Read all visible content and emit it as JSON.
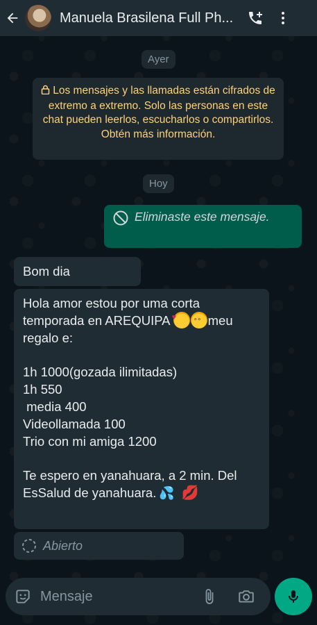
{
  "header": {
    "contact_name": "Manuela Brasilena Full Ph..."
  },
  "chat": {
    "date_yesterday": "Ayer",
    "encryption_notice": "Los mensajes y las llamadas están cifrados de extremo a extremo. Solo las personas en este chat pueden leerlos, escucharlos o compartirlos. Obtén más información.",
    "date_today": "Hoy",
    "outgoing_deleted": "Eliminaste este mensaje.",
    "incoming_1": "Bom dia",
    "incoming_2": {
      "line1": "Hola amor estou por uma corta",
      "line2": "temporada en AREQUIPA",
      "line2b": "meu",
      "line3": "regalo e:",
      "line4": "1h 1000(gozada ilimitadas)",
      "line5": "1h 550",
      "line6": " media 400",
      "line7": "Videollamada 100",
      "line8": "Trio con mi amiga 1200",
      "line9": "Te espero en yanahuara, a 2 min. Del",
      "line10": "EsSalud de yanahuara."
    },
    "view_once": "Abierto"
  },
  "composer": {
    "placeholder": "Mensaje"
  },
  "colors": {
    "background": "#0b141a",
    "header": "#1f2c34",
    "outgoing": "#005c4b",
    "incoming": "#1f2c34",
    "accent": "#00a884",
    "notice_text": "#ffd279"
  },
  "icons": [
    "back-arrow-icon",
    "add-call-icon",
    "more-vert-icon",
    "lock-icon",
    "block-icon",
    "loading-icon",
    "sticker-icon",
    "attach-icon",
    "camera-icon",
    "mic-icon"
  ]
}
